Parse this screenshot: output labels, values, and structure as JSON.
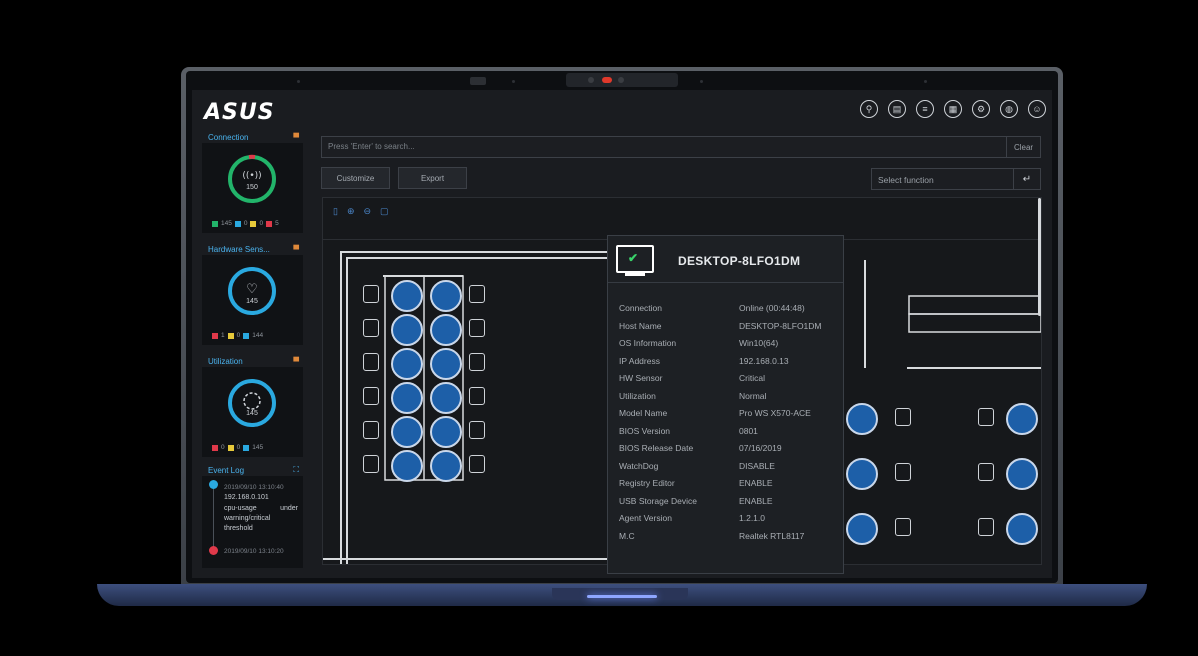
{
  "brand": "ASUS",
  "topbar_icons": [
    "map-icon",
    "printer-icon",
    "list-icon",
    "building-icon",
    "gear-icon",
    "globe-icon",
    "user-icon"
  ],
  "sidebar": {
    "connection": {
      "title": "Connection",
      "center_value": "150",
      "legend": [
        {
          "color": "#22b46a",
          "value": "145"
        },
        {
          "color": "#2aa9e0",
          "value": "0"
        },
        {
          "color": "#e6c93a",
          "value": "0"
        },
        {
          "color": "#e0394a",
          "value": "5"
        }
      ]
    },
    "hardware": {
      "title": "Hardware Sens...",
      "center_value": "145",
      "legend": [
        {
          "color": "#e0394a",
          "value": "1"
        },
        {
          "color": "#e6c93a",
          "value": "0"
        },
        {
          "color": "#2aa9e0",
          "value": "144"
        }
      ]
    },
    "utilization": {
      "title": "Utilization",
      "center_value": "145",
      "legend": [
        {
          "color": "#e0394a",
          "value": "0"
        },
        {
          "color": "#e6c93a",
          "value": "0"
        },
        {
          "color": "#2aa9e0",
          "value": "145"
        }
      ]
    },
    "event_log": {
      "title": "Event Log",
      "entries": [
        {
          "time": "2019/09/10 13:10:40",
          "ip": "192.168.0.101",
          "msg": "cpu-usage under warning/critical threshold"
        },
        {
          "time": "2019/09/10 13:10:20"
        }
      ]
    }
  },
  "search": {
    "placeholder": "Press 'Enter' to search...",
    "clear_label": "Clear"
  },
  "toolbar": {
    "customize_label": "Customize",
    "export_label": "Export",
    "select_function": "Select function"
  },
  "popup": {
    "title": "DESKTOP-8LFO1DM",
    "rows": [
      {
        "k": "Connection",
        "v": "Online (00:44:48)"
      },
      {
        "k": "Host Name",
        "v": "DESKTOP-8LFO1DM"
      },
      {
        "k": "OS Information",
        "v": "Win10(64)"
      },
      {
        "k": "IP Address",
        "v": "192.168.0.13"
      },
      {
        "k": "HW Sensor",
        "v": "Critical"
      },
      {
        "k": "Utilization",
        "v": "Normal"
      },
      {
        "k": "Model Name",
        "v": "Pro WS X570-ACE"
      },
      {
        "k": "BIOS Version",
        "v": "0801"
      },
      {
        "k": "BIOS Release Date",
        "v": "07/16/2019"
      },
      {
        "k": "WatchDog",
        "v": "DISABLE"
      },
      {
        "k": "Registry Editor",
        "v": "ENABLE"
      },
      {
        "k": "USB Storage Device",
        "v": "ENABLE"
      },
      {
        "k": "Agent Version",
        "v": "1.2.1.0"
      },
      {
        "k": "M.C",
        "v": "Realtek RTL8117"
      }
    ]
  }
}
